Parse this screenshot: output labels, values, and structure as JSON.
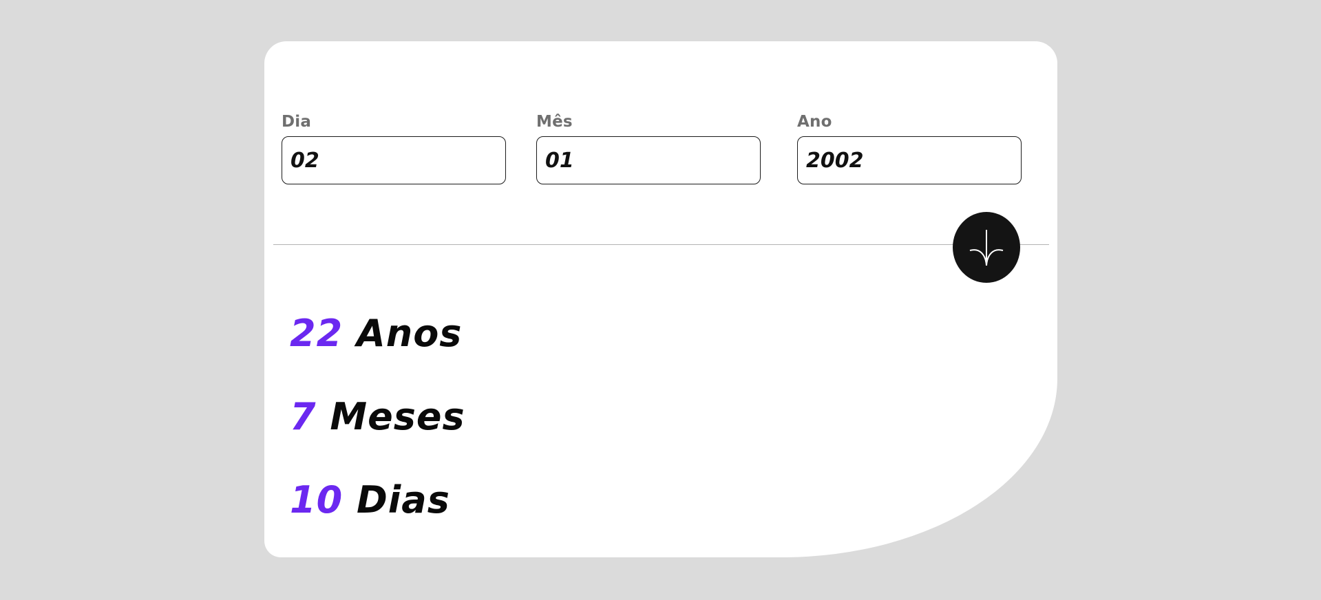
{
  "form": {
    "day": {
      "label": "Dia",
      "value": "02"
    },
    "month": {
      "label": "Mês",
      "value": "01"
    },
    "year": {
      "label": "Ano",
      "value": "2002"
    }
  },
  "submit": {
    "icon": "arrow-down-icon"
  },
  "results": {
    "years": {
      "value": "22",
      "unit": "Anos"
    },
    "months": {
      "value": "7",
      "unit": "Meses"
    },
    "days": {
      "value": "10",
      "unit": "Dias"
    }
  },
  "colors": {
    "accent": "#6b28f0",
    "background": "#dbdbdb",
    "card": "#ffffff",
    "button": "#141414"
  }
}
